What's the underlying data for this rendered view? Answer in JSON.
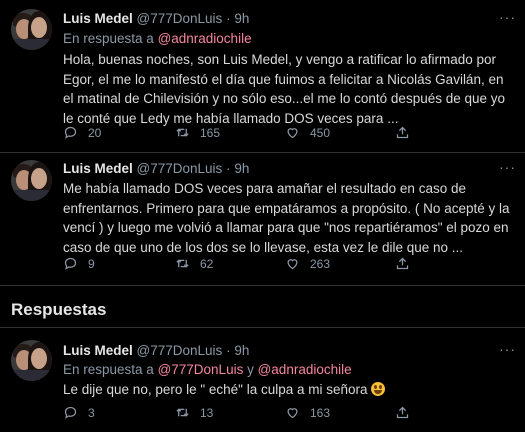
{
  "tweets": [
    {
      "name": "Luis Medel",
      "handle": "@777DonLuis",
      "dot": "·",
      "time": "9h",
      "more": "···",
      "reply_prefix": "En respuesta a ",
      "reply_to": "@adnradiochile",
      "reply_and": "",
      "reply_to2": "",
      "text": "Hola, buenas noches, son Luis Medel, y vengo a ratificar lo afirmado por Egor, el me lo manifestó el día que fuimos a felicitar a Nicolás Gavilán, en el matinal de Chilevisión y no sólo eso...el me lo contó después de que yo le conté que Ledy me había llamado DOS veces para ...",
      "replies": "20",
      "retweets": "165",
      "likes": "450"
    },
    {
      "name": "Luis Medel",
      "handle": "@777DonLuis",
      "dot": "·",
      "time": "9h",
      "more": "···",
      "text": "Me había llamado DOS veces para amañar el resultado en caso de enfrentarnos. Primero para que empatáramos a propósito. ( No acepté y la vencí ) y luego me volvió a llamar para que \"nos repartiéramos\" el pozo en caso de que uno de los dos se lo llevase, esta vez le dile que no ...",
      "replies": "9",
      "retweets": "62",
      "likes": "263"
    },
    {
      "name": "Luis Medel",
      "handle": "@777DonLuis",
      "dot": "·",
      "time": "9h",
      "more": "···",
      "reply_prefix": "En respuesta a ",
      "reply_to": "@777DonLuis",
      "reply_and": " y ",
      "reply_to2": "@adnradiochile",
      "text": "Le dije que  no, pero le \" eché\" la culpa a mi señora ",
      "replies": "3",
      "retweets": "13",
      "likes": "163"
    }
  ],
  "section_title": "Respuestas",
  "colors": {
    "background": "#000000",
    "text": "#d9d9d9",
    "muted": "#8b98a5",
    "link": "#ff4f7b",
    "divider": "#2f3336"
  },
  "icons": {
    "reply": "reply-icon",
    "retweet": "retweet-icon",
    "like": "like-icon",
    "share": "share-icon",
    "emoji": "grinning-emoji-icon"
  }
}
